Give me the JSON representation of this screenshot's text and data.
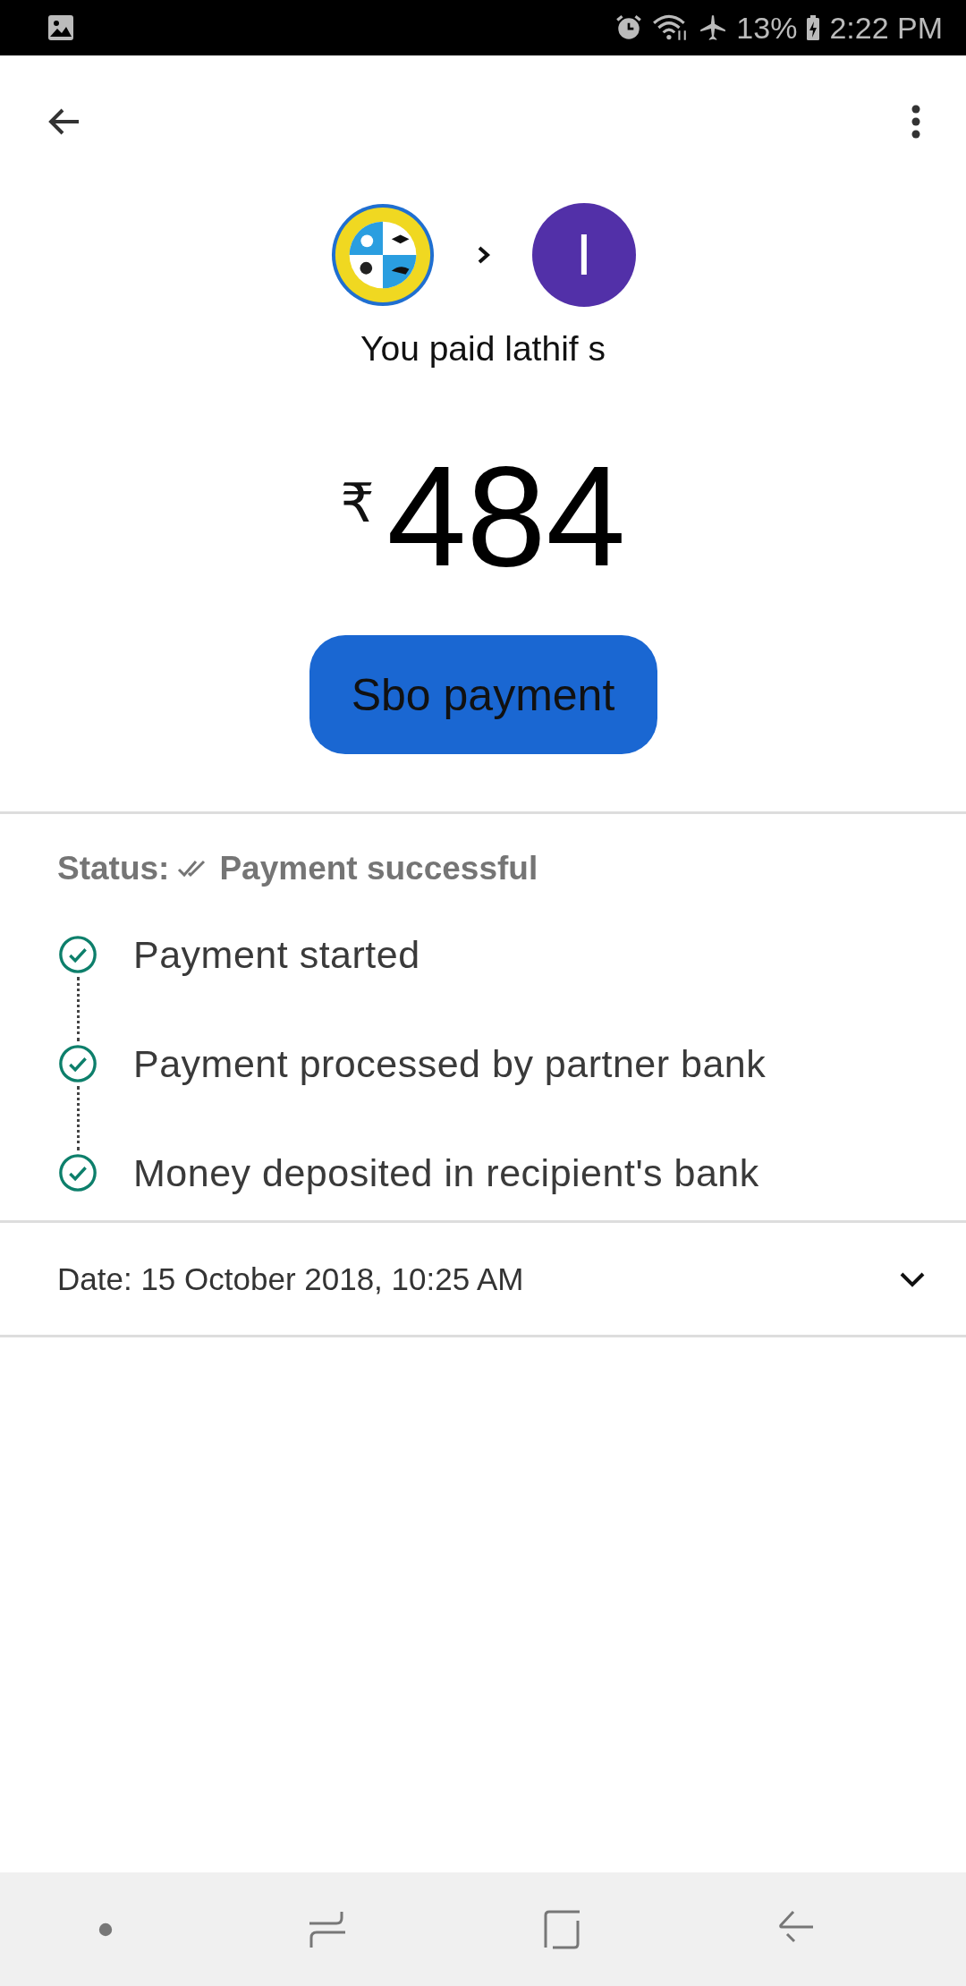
{
  "status_bar": {
    "battery": "13%",
    "time": "2:22 PM"
  },
  "payment": {
    "avatar_letter": "I",
    "headline": "You paid lathif s",
    "currency": "₹",
    "amount": "484",
    "note": "Sbo payment"
  },
  "status": {
    "label": "Status:",
    "value": "Payment successful"
  },
  "steps": [
    {
      "label": "Payment started",
      "done": true
    },
    {
      "label": "Payment processed by partner bank",
      "done": true
    },
    {
      "label": "Money deposited in recipient's bank",
      "done": true
    }
  ],
  "date_row": {
    "text": "Date: 15 October 2018, 10:25 AM",
    "expanded": false
  }
}
